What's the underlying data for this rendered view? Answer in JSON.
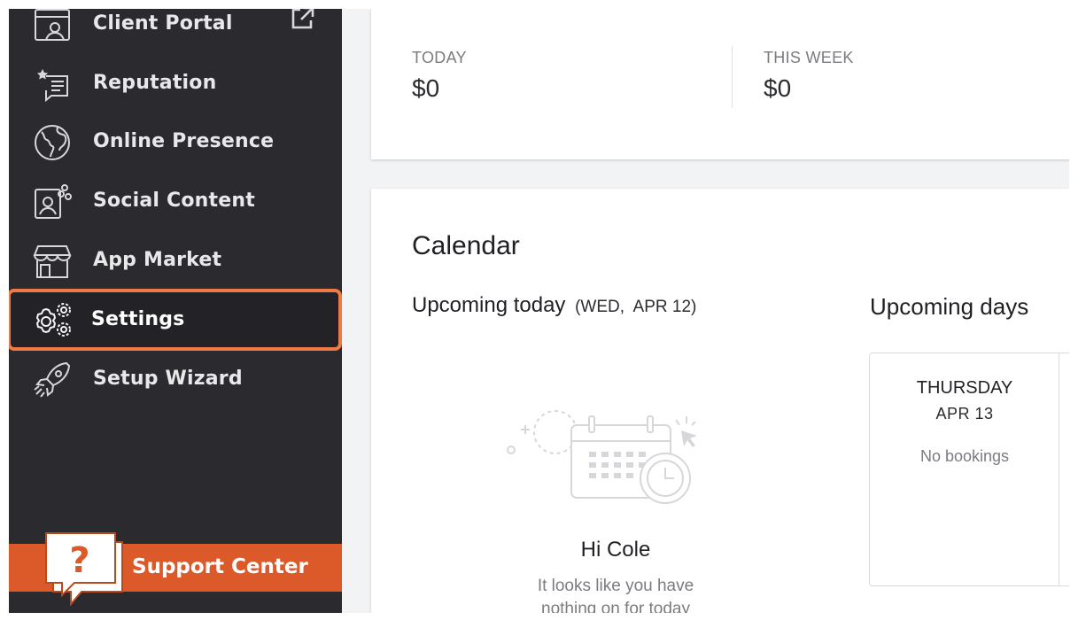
{
  "sidebar": {
    "items": [
      {
        "label": "Client Portal",
        "icon": "client-portal-icon"
      },
      {
        "label": "Reputation",
        "icon": "reputation-icon"
      },
      {
        "label": "Online Presence",
        "icon": "globe-icon"
      },
      {
        "label": "Social Content",
        "icon": "social-content-icon"
      },
      {
        "label": "App Market",
        "icon": "storefront-icon"
      },
      {
        "label": "Settings",
        "icon": "gears-icon"
      },
      {
        "label": "Setup Wizard",
        "icon": "rocket-icon"
      }
    ],
    "active": "Settings",
    "support_label": "Support Center"
  },
  "stats": {
    "today_label": "TODAY",
    "today_value": "$0",
    "week_label": "THIS WEEK",
    "week_value": "$0"
  },
  "calendar": {
    "title": "Calendar",
    "upcoming_today_label": "Upcoming today",
    "today_date": "(WED,  APR 12)",
    "upcoming_days_label": "Upcoming days",
    "empty_greeting": "Hi Cole",
    "empty_message": "It looks like you have nothing on for today",
    "days": [
      {
        "name": "THURSDAY",
        "date": "APR 13",
        "status": "No bookings"
      }
    ]
  },
  "colors": {
    "sidebar_bg": "#2a2a2f",
    "active_border": "#ef7a45",
    "support_bg": "#dc5a29"
  }
}
